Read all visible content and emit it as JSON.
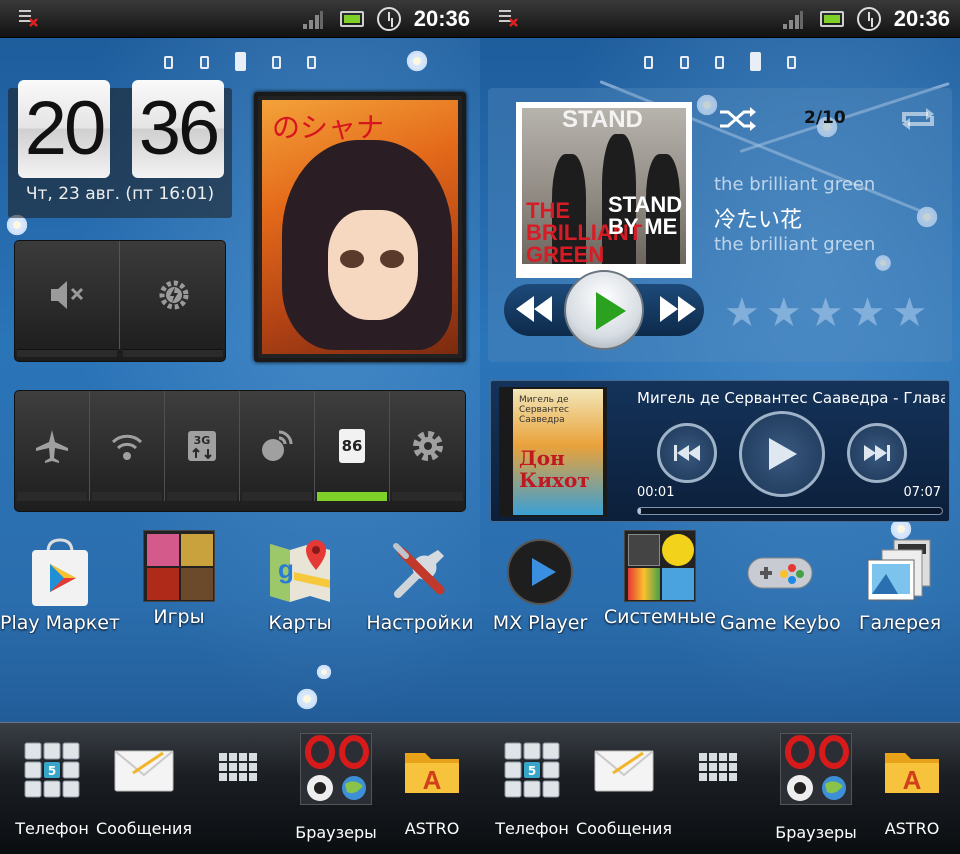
{
  "status": {
    "time": "20:36"
  },
  "left": {
    "clock": {
      "hours": "20",
      "minutes": "36",
      "date": "Чт, 23 авг. (пт 16:01)"
    },
    "photo": {
      "title": "のシャナ"
    },
    "toggles": [
      {
        "icon": "airplane-icon",
        "on": false
      },
      {
        "icon": "wifi-icon",
        "on": false
      },
      {
        "icon": "mobile-data-icon",
        "on": false
      },
      {
        "icon": "gps-icon",
        "on": false
      },
      {
        "icon": "battery-icon",
        "on": true,
        "value": "86"
      },
      {
        "icon": "settings-icon",
        "on": false
      }
    ],
    "apps": [
      {
        "label": "Play Маркет",
        "icon": "play-store-icon"
      },
      {
        "label": "Игры",
        "icon": "games-folder-icon"
      },
      {
        "label": "Карты",
        "icon": "maps-icon"
      },
      {
        "label": "Настройки",
        "icon": "settings-tools-icon"
      }
    ]
  },
  "right": {
    "music": {
      "counter": "2/10",
      "artist": "the brilliant green",
      "title": "冷たい花",
      "album": "the brilliant green",
      "cover_top": "STAND",
      "cover_band": "THE BRILLIANT GREEN",
      "cover_stand": "STAND BY ME",
      "rating_stars": 5
    },
    "mx": {
      "title": "Мигель де Сервантес Сааведра - Глава...",
      "elapsed": "00:01",
      "total": "07:07",
      "progress": 0.01,
      "cover_author": "Мигель де Сервантес Сааведра",
      "cover_title": "Дон Кихот"
    },
    "apps": [
      {
        "label": "MX Player",
        "icon": "mx-player-icon"
      },
      {
        "label": "Системные",
        "icon": "system-folder-icon"
      },
      {
        "label": "Game Keybo",
        "icon": "gamepad-icon"
      },
      {
        "label": "Галерея",
        "icon": "gallery-icon"
      }
    ]
  },
  "dock": {
    "left": [
      "Телефон",
      "Сообщения",
      "",
      "Браузеры",
      "ASTRO"
    ],
    "right": [
      "Телефон",
      "Сообщения",
      "",
      "Браузеры",
      "ASTRO"
    ]
  },
  "colors": {
    "accent_green": "#7fd12a",
    "wallpaper_blue": "#2a74b8"
  }
}
